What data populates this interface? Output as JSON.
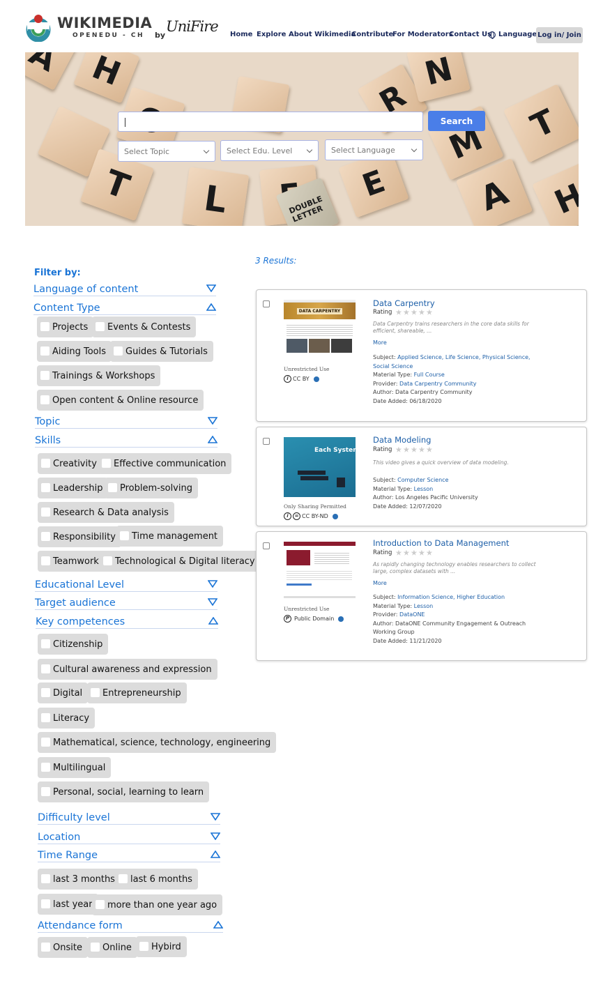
{
  "brand": {
    "title": "WIKIMEDIA",
    "subtitle": "OPENEDU - CH",
    "by": "by",
    "partner": "UniFire"
  },
  "nav": {
    "home": "Home",
    "explore": "Explore",
    "about": "About Wikimedia",
    "contribute": "Contribute",
    "moderators": "For Moderators",
    "contact": "Contact Us",
    "language": "Language",
    "login": "Log in/ Join"
  },
  "hero": {
    "search_value": "",
    "search_button": "Search",
    "select_topic": "Select Topic",
    "select_level": "Select Edu. Level",
    "select_language": "Select Language"
  },
  "filters": {
    "heading": "Filter by:",
    "language_of_content": "Language of content",
    "content_type": {
      "label": "Content Type",
      "options": [
        "Projects",
        "Events & Contests",
        "Aiding Tools",
        "Guides & Tutorials",
        "Trainings & Workshops",
        "Open content & Online resource"
      ]
    },
    "topic": "Topic",
    "skills": {
      "label": "Skills",
      "options": [
        "Creativity",
        "Effective communication",
        "Leadership",
        "Problem-solving",
        "Research & Data analysis",
        "Responsibility",
        "Time management",
        "Teamwork",
        "Technological & Digital literacy"
      ]
    },
    "educational_level": "Educational Level",
    "target_audience": "Target audience",
    "key_competences": {
      "label": "Key competences",
      "options": [
        "Citizenship",
        "Cultural awareness and expression",
        "Digital",
        "Entrepreneurship",
        "Literacy",
        "Mathematical, science, technology, engineering",
        "Multilingual",
        "Personal, social, learning to learn"
      ]
    },
    "difficulty_level": "Difficulty level",
    "location": "Location",
    "time_range": {
      "label": "Time Range",
      "options": [
        "last 3 months",
        "last 6 months",
        "last year",
        "more than one year ago"
      ]
    },
    "attendance_form": {
      "label": "Attendance form",
      "options": [
        "Onsite",
        "Online",
        "Hybird"
      ]
    }
  },
  "results": {
    "count": "3 Results:",
    "rating_label": "Rating",
    "items": [
      {
        "title": "Data Carpentry",
        "desc": "Data Carpentry trains researchers in the core data skills for efficient, shareable, ...",
        "more": "More",
        "subject_label": "Subject:",
        "subject": "Applied Science, Life Science, Physical Science, Social Science",
        "material_label": "Material Type:",
        "material": "Full Course",
        "provider_label": "Provider:",
        "provider": "Data Carpentry Community",
        "author": "Author: Data Carpentry Community",
        "date": "Date Added: 06/18/2020",
        "usage": "Unrestricted Use",
        "license": "CC BY",
        "thumb_caption": "DATA CARPENTRY"
      },
      {
        "title": "Data Modeling",
        "desc": "This video gives a quick overview of data modeling.",
        "subject_label": "Subject:",
        "subject": "Computer Science",
        "material_label": "Material Type:",
        "material": "Lesson",
        "author": "Author: Los Angeles Pacific University",
        "date": "Date Added: 12/07/2020",
        "usage": "Only Sharing Permitted",
        "license": "CC BY-ND",
        "thumb_caption": "Each System is Un"
      },
      {
        "title": "Introduction to Data Management",
        "desc": "As rapidly changing technology enables researchers to collect large, complex datasets with ...",
        "more": "More",
        "subject_label": "Subject:",
        "subject": "Information Science, Higher Education",
        "material_label": "Material Type:",
        "material": "Lesson",
        "provider_label": "Provider:",
        "provider": "DataONE",
        "author": "Author: DataONE Community Engagement & Outreach Working Group",
        "date": "Date Added: 11/21/2020",
        "usage": "Unrestricted Use",
        "license": "Public Domain"
      }
    ]
  },
  "colors": {
    "accent": "#1a74d6",
    "search_button": "#4a7ee8",
    "nav_text": "#1b2a5c"
  }
}
